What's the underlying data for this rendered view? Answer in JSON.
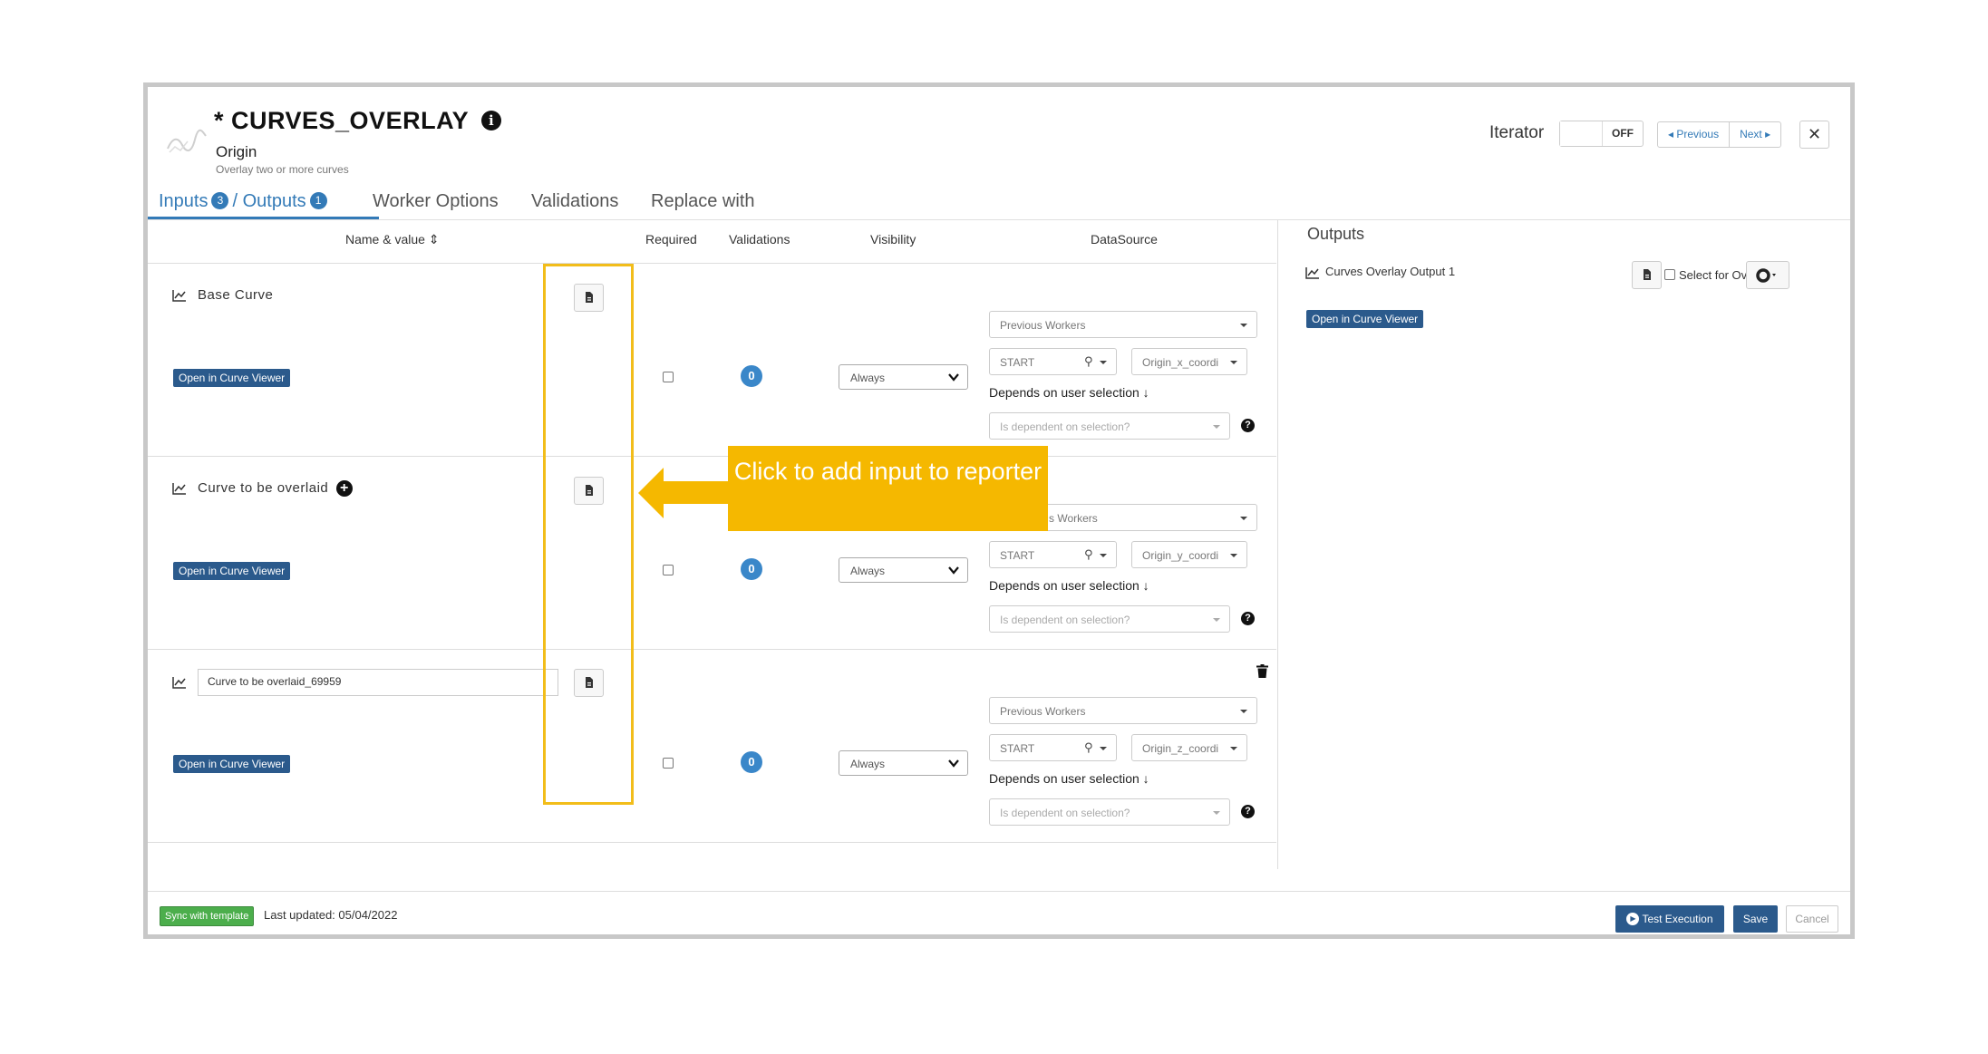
{
  "header": {
    "title": "* CURVES_OVERLAY",
    "subtitle": "Origin",
    "description": "Overlay two or more curves",
    "iterator_label": "Iterator",
    "iterator_state": "OFF",
    "previous_label": "Previous",
    "next_label": "Next",
    "close_label": "✕"
  },
  "tabs": {
    "inputs_label": "Inputs",
    "inputs_count": "3",
    "outputs_label": "/ Outputs",
    "outputs_count": "1",
    "worker_options": "Worker Options",
    "validations": "Validations",
    "replace_with": "Replace with"
  },
  "columns": {
    "name_value": "Name & value",
    "required": "Required",
    "validations": "Validations",
    "visibility": "Visibility",
    "datasource": "DataSource"
  },
  "rows": [
    {
      "label": "Base Curve",
      "curve_button": "Open in Curve Viewer",
      "validations_count": "0",
      "visibility": "Always",
      "ds_source": "Previous Workers",
      "ds_start": "START",
      "ds_field": "Origin_x_coordi",
      "depends_label": "Depends on user selection",
      "dependent_placeholder": "Is dependent on selection?"
    },
    {
      "label": "Curve to be overlaid",
      "curve_button": "Open in Curve Viewer",
      "validations_count": "0",
      "visibility": "Always",
      "ds_source": "s Workers",
      "ds_start": "START",
      "ds_field": "Origin_y_coordi",
      "depends_label": "Depends on user selection",
      "dependent_placeholder": "Is dependent on selection?"
    },
    {
      "label": "Curve to be overlaid_69959",
      "curve_button": "Open in Curve Viewer",
      "validations_count": "0",
      "visibility": "Always",
      "ds_source": "Previous Workers",
      "ds_start": "START",
      "ds_field": "Origin_z_coordi",
      "depends_label": "Depends on user selection",
      "dependent_placeholder": "Is dependent on selection?"
    }
  ],
  "callout": {
    "text": "Click to add input to reporter"
  },
  "outputs": {
    "title": "Outputs",
    "item_label": "Curves Overlay Output 1",
    "select_label": "Select for Overlay",
    "curve_button": "Open in Curve Viewer"
  },
  "footer": {
    "sync_label": "Sync with template",
    "last_updated": "Last updated: 05/04/2022",
    "test_label": "Test Execution",
    "save_label": "Save",
    "cancel_label": "Cancel"
  },
  "colors": {
    "accent": "#337ab7",
    "button_blue": "#2b5a8c",
    "highlight_yellow": "#f5b800",
    "sync_green": "#4cae4c"
  }
}
